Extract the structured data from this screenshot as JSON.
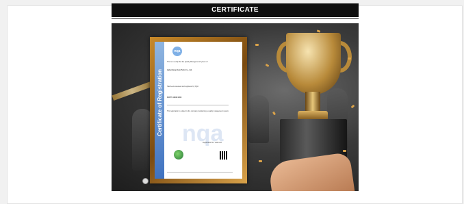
{
  "header": {
    "title": "CERTIFICATE"
  },
  "banner": {
    "icons": [
      "certificate-image",
      "trophy-image",
      "hand-image",
      "confetti"
    ],
    "colors": {
      "header_bg": "#0f0f0f",
      "frame_gold": "#c88a2a",
      "trophy_gold": "#b88a3a"
    }
  },
  "certificate": {
    "logo": "nqa",
    "vertical_title": "Certificate of Registration",
    "watermark": "nqa",
    "lines": [
      "This is to certify that the Quality Management System of:",
      "Hubei Hanyi Auto Parts Co., Ltd.",
      "Has been assessed and registered by NQA",
      "ISO/TS 16949:2009",
      "This registration is subject to the company maintaining a quality management system",
      "Registration No. valid until"
    ]
  }
}
